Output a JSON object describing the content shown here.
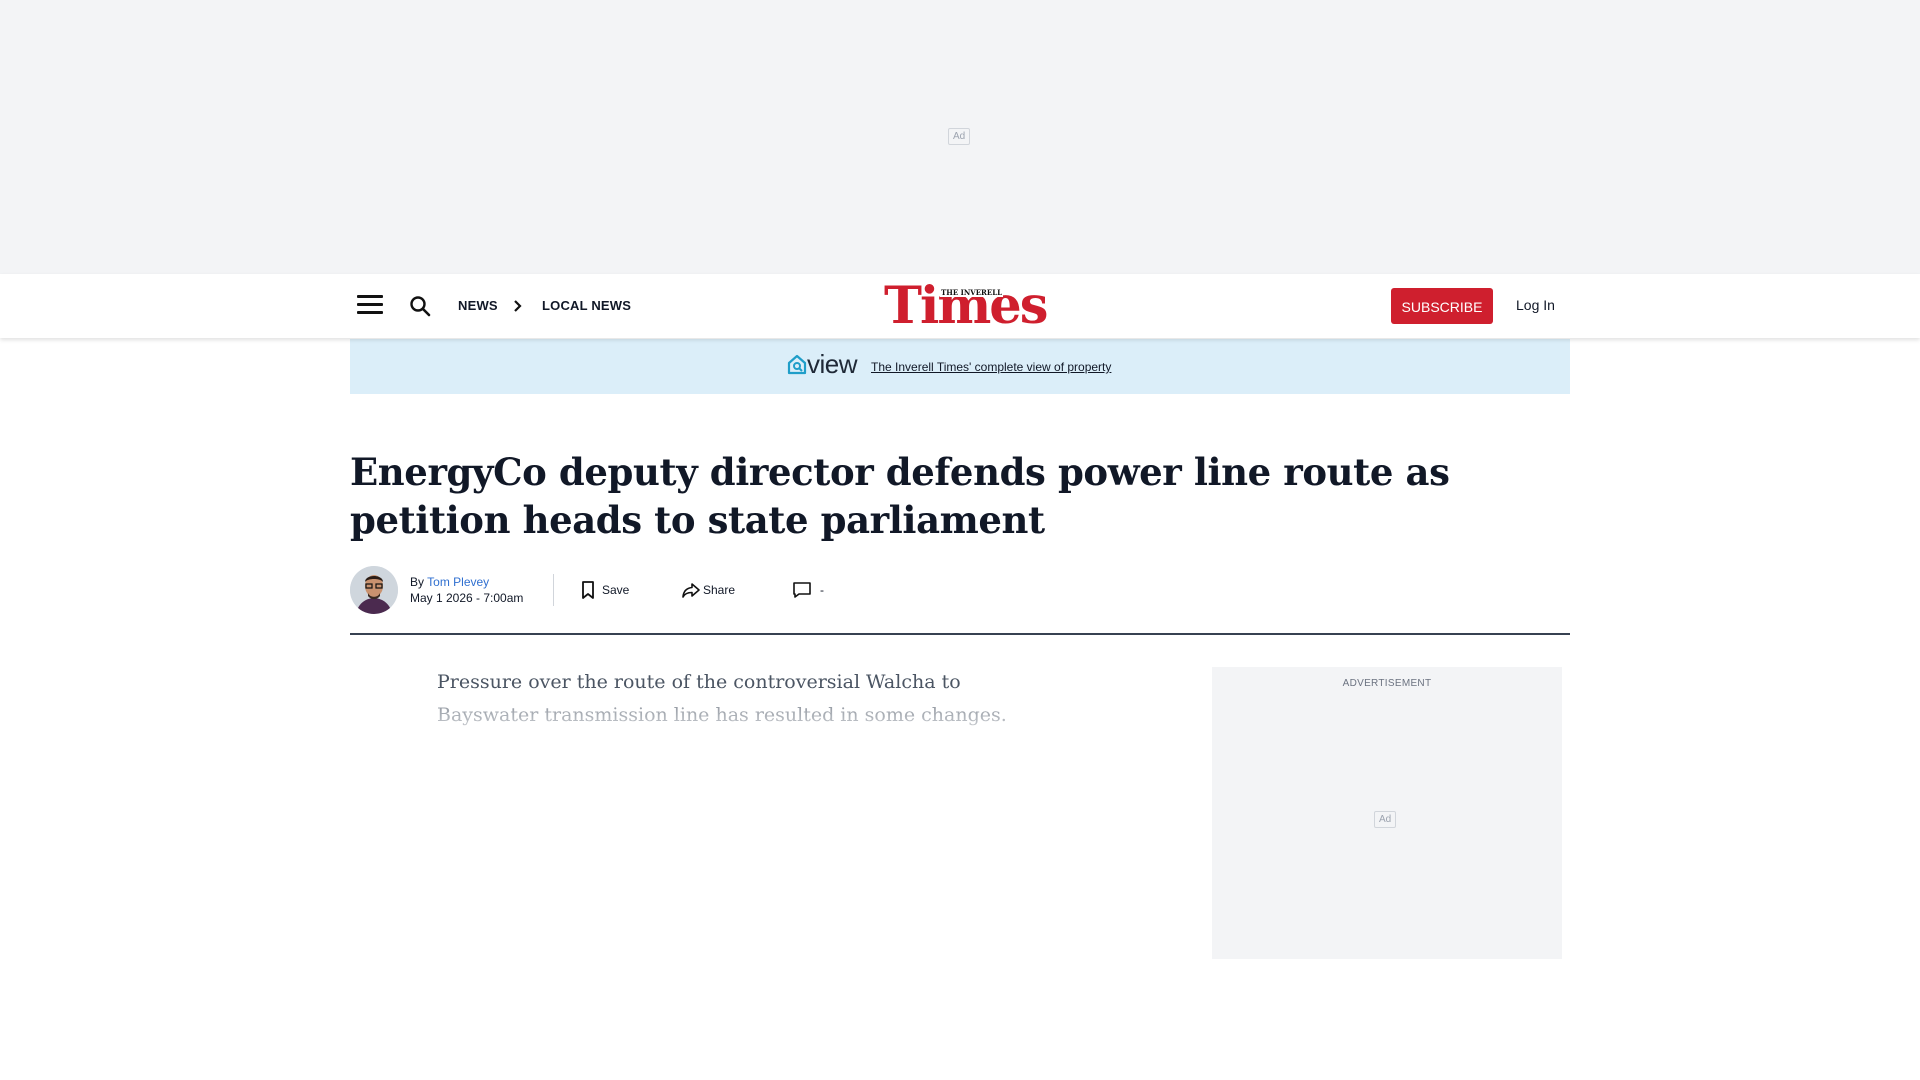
{
  "top_ad": {
    "tag": "Ad"
  },
  "header": {
    "breadcrumbs": [
      "NEWS",
      "LOCAL NEWS"
    ],
    "logo": {
      "word": "Times",
      "superscript": "THE INVERELL"
    },
    "subscribe_label": "SUBSCRIBE",
    "login_label": "Log In",
    "icons": [
      "menu-icon",
      "search-icon",
      "chevron-right-icon"
    ],
    "brand_color": "#cf1f2e"
  },
  "promo": {
    "logo_text": "view",
    "link_text": "The Inverell Times' complete view of property",
    "background": "#dbeef9"
  },
  "article": {
    "headline": "EnergyCo deputy director defends power line route as petition heads to state parliament",
    "byline_prefix": "By",
    "author": "Tom Plevey",
    "date": "May 1 2026 - 7:00am",
    "actions": {
      "save": "Save",
      "share": "Share",
      "comments": "-"
    },
    "lede": "Pressure over the route of the controversial Walcha to Bayswater transmission line has resulted in some changes."
  },
  "side_ad": {
    "label": "ADVERTISEMENT",
    "tag": "Ad"
  }
}
